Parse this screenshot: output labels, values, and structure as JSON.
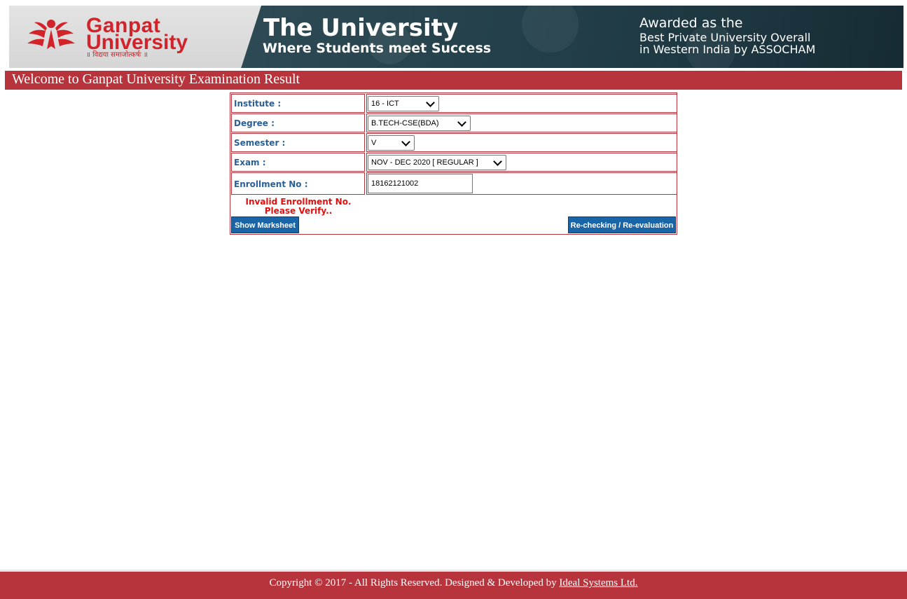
{
  "banner": {
    "logo_line1": "Ganpat",
    "logo_line2": "University",
    "logo_tagline": "॥ विद्यया समाजोत्कर्षः ॥",
    "title": "The University",
    "subtitle": "Where Students meet Success",
    "award_line1": "Awarded as the",
    "award_line2": "Best Private University Overall",
    "award_line3": "in Western India by ASSOCHAM"
  },
  "header": {
    "title": "Welcome to Ganpat University Examination Result"
  },
  "form": {
    "institute": {
      "label": "Institute :",
      "value": "16 - ICT"
    },
    "degree": {
      "label": "Degree :",
      "value": "B.TECH-CSE(BDA)"
    },
    "semester": {
      "label": "Semester :",
      "value": "V"
    },
    "exam": {
      "label": "Exam :",
      "value": "NOV - DEC 2020 [ REGULAR ]"
    },
    "enrollment": {
      "label": "Enrollment No :",
      "value": "18162121002"
    },
    "error_message": "Invalid Enrollment No. Please Verify..",
    "show_button": "Show Marksheet",
    "recheck_button": "Re-checking / Re-evaluation"
  },
  "footer": {
    "text": "Copyright © 2017 - All Rights Reserved. Designed & Developed by ",
    "link": "Ideal Systems Ltd."
  },
  "colors": {
    "brand_red": "#b7343c",
    "label_blue": "#2a5f98",
    "button_blue": "#1a64a8",
    "error_red": "#e01010"
  }
}
